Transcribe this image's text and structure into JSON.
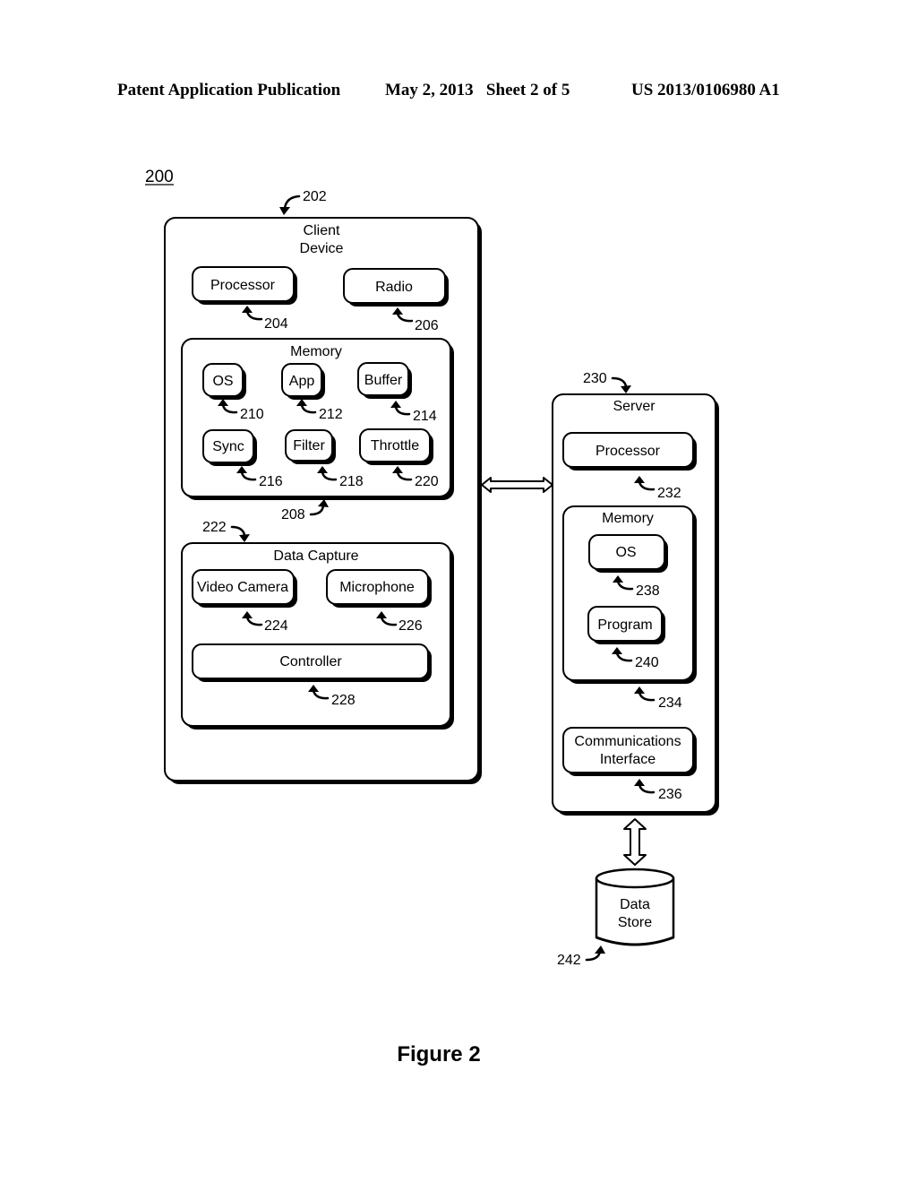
{
  "header": {
    "publication": "Patent Application Publication",
    "date_sheet": "May 2, 2013   Sheet 2 of 5",
    "number": "US 2013/0106980 A1"
  },
  "figure": {
    "ref": "200",
    "caption": "Figure 2"
  },
  "client": {
    "title_line1": "Client",
    "title_line2": "Device",
    "ref": "202",
    "processor": {
      "label": "Processor",
      "ref": "204"
    },
    "radio": {
      "label": "Radio",
      "ref": "206"
    },
    "memory": {
      "label": "Memory",
      "ref": "208",
      "items": [
        {
          "label": "OS",
          "ref": "210"
        },
        {
          "label": "App",
          "ref": "212"
        },
        {
          "label": "Buffer",
          "ref": "214"
        },
        {
          "label": "Sync",
          "ref": "216"
        },
        {
          "label": "Filter",
          "ref": "218"
        },
        {
          "label": "Throttle",
          "ref": "220"
        }
      ]
    },
    "data_capture": {
      "label": "Data Capture",
      "ref": "222",
      "video_camera": {
        "label": "Video Camera",
        "ref": "224"
      },
      "microphone": {
        "label": "Microphone",
        "ref": "226"
      },
      "controller": {
        "label": "Controller",
        "ref": "228"
      }
    }
  },
  "server": {
    "title": "Server",
    "ref": "230",
    "processor": {
      "label": "Processor",
      "ref": "232"
    },
    "memory": {
      "label": "Memory",
      "ref": "234",
      "os": {
        "label": "OS",
        "ref": "238"
      },
      "program": {
        "label": "Program",
        "ref": "240"
      }
    },
    "comm": {
      "label_line1": "Communications",
      "label_line2": "Interface",
      "ref": "236"
    }
  },
  "data_store": {
    "label_line1": "Data",
    "label_line2": "Store",
    "ref": "242"
  }
}
